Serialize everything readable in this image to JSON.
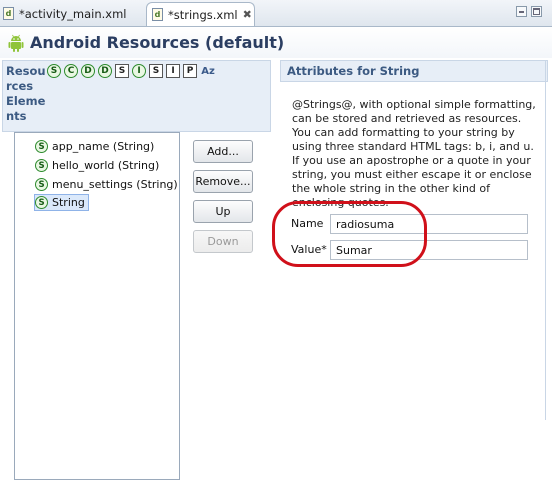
{
  "tabs": [
    {
      "label": "*activity_main.xml",
      "active": false
    },
    {
      "label": "*strings.xml",
      "active": true,
      "close": "✖"
    }
  ],
  "header": {
    "title": "Android Resources (default)"
  },
  "resources": {
    "heading": "Resou\nrces\nEleme\nnts",
    "toolbar_buttons": [
      {
        "glyph": "S",
        "icon": "string-icon"
      },
      {
        "glyph": "C",
        "icon": "color-icon"
      },
      {
        "glyph": "D",
        "icon": "dimension-icon"
      },
      {
        "glyph": "D",
        "icon": "drawable-icon"
      },
      {
        "glyph": "S",
        "icon": "style-icon"
      },
      {
        "glyph": "I",
        "icon": "item-icon"
      },
      {
        "glyph": "S",
        "icon": "string-array-icon"
      },
      {
        "glyph": "I",
        "icon": "integer-array-icon"
      },
      {
        "glyph": "P",
        "icon": "plurals-icon"
      },
      {
        "glyph": "Az",
        "icon": "sort-icon"
      }
    ],
    "items": [
      {
        "label": "app_name (String)",
        "selected": false
      },
      {
        "label": "hello_world (String)",
        "selected": false
      },
      {
        "label": "menu_settings (String)",
        "selected": false
      },
      {
        "label": "String",
        "selected": true
      }
    ],
    "buttons": {
      "add": "Add...",
      "remove": "Remove...",
      "up": "Up",
      "down": "Down"
    }
  },
  "attributes": {
    "heading": "Attributes for String",
    "description": "@Strings@, with optional simple formatting, can be stored and retrieved as resources. You can add formatting to your string by using three standard HTML tags: b, i, and u. If you use an apostrophe or a quote in your string, you must either escape it or enclose the whole string in the other kind of enclosing quotes.",
    "fields": {
      "name_label": "Name",
      "name_value": "radiosuma",
      "value_label": "Value*",
      "value_value": "Sumar"
    }
  },
  "colors": {
    "highlight_oval": "#d0101a",
    "section_header": "#e7eef7",
    "title_text": "#2b3e62"
  }
}
